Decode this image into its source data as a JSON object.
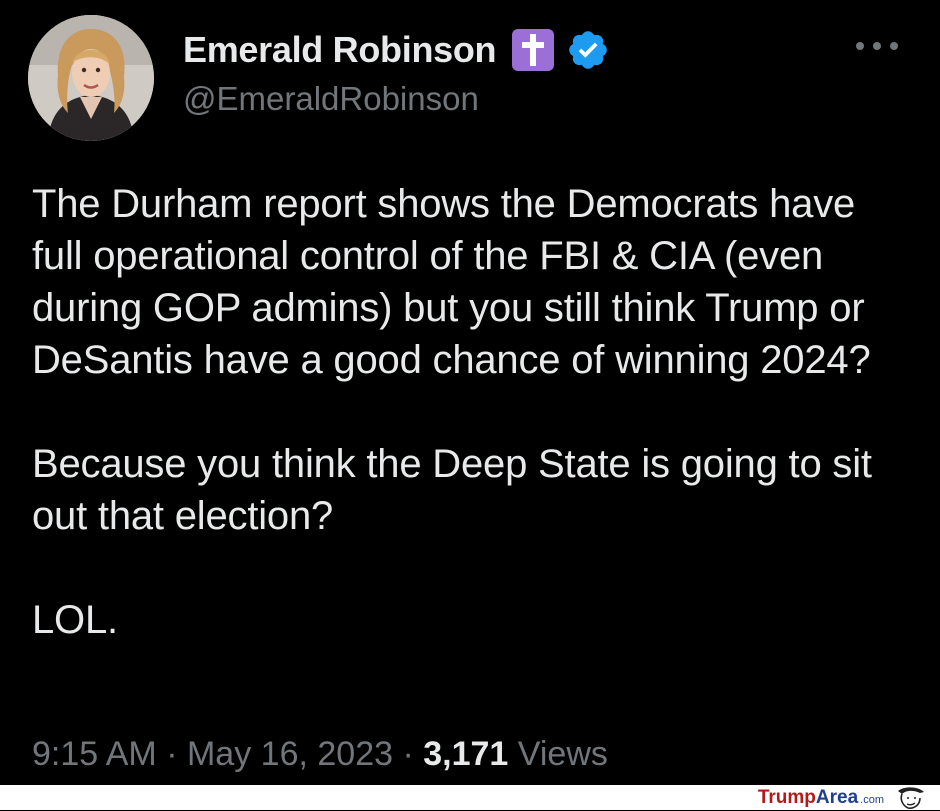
{
  "author": {
    "display_name": "Emerald Robinson",
    "handle": "@EmeraldRobinson",
    "badges": [
      "latin-cross-icon",
      "verified-badge-icon"
    ]
  },
  "tweet": {
    "paragraphs": [
      "The Durham report shows the Democrats have full operational control of the FBI & CIA (even during GOP admins) but you still think Trump or DeSantis have a good chance of winning 2024?",
      "Because you think the Deep State is going to sit out that election?",
      "LOL."
    ]
  },
  "meta": {
    "time": "9:15 AM",
    "separator": "·",
    "date": "May 16, 2023",
    "views_count": "3,171",
    "views_label": "Views"
  },
  "watermark": {
    "trump": "Trump",
    "area": "Area",
    "com": ".com"
  },
  "colors": {
    "background": "#000000",
    "text_primary": "#e7e9ea",
    "text_secondary": "#71767b",
    "verified_blue": "#1d9bf0",
    "cross_badge": "#9b6fd6"
  }
}
